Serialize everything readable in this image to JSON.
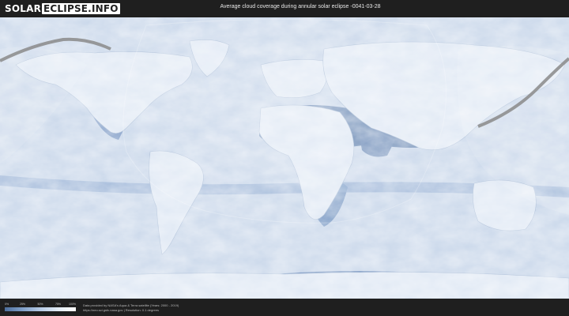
{
  "header": {
    "logo_part1": "SOLAR",
    "logo_part2": "ECLIPSE.INFO",
    "title": "Average cloud coverage during annular solar eclipse -0041-03-28"
  },
  "legend": {
    "ticks": [
      "0%",
      "25%",
      "50%",
      "75%",
      "100%"
    ],
    "low_color": "#4d6e9c",
    "high_color": "#ffffff"
  },
  "credits": {
    "line1": "Data provided by NASA's Aqua & Terra satellite (Years: 2000 - 2019)",
    "line2": "https://neo.sci.gsfc.nasa.gov | Resolution: 0.1 degrees"
  },
  "colors": {
    "background": "#1f1f1f",
    "ocean_cloud": "#c9d7ea",
    "clear_sky": "#4d6e9c",
    "eclipse_path": "#8a8a8a"
  }
}
